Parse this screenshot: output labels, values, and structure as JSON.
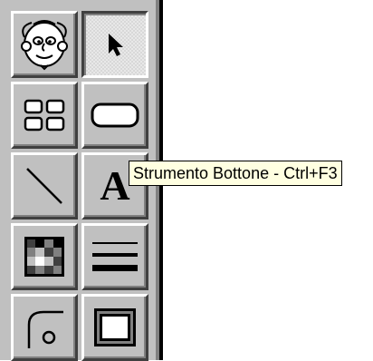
{
  "tooltip": {
    "text": "Strumento Bottone - Ctrl+F3"
  },
  "tools": [
    {
      "name": "macro-character-tool",
      "icon": "cartoon-face-icon"
    },
    {
      "name": "selection-tool",
      "icon": "pointer-arrow-icon",
      "pressed": true
    },
    {
      "name": "grid-object-tool",
      "icon": "grid-boxes-icon"
    },
    {
      "name": "button-tool",
      "icon": "rounded-rectangle-icon"
    },
    {
      "name": "line-tool",
      "icon": "diagonal-line-icon"
    },
    {
      "name": "text-tool",
      "icon": "letter-a-icon",
      "glyph": "A"
    },
    {
      "name": "color-tool",
      "icon": "color-palette-grid-icon"
    },
    {
      "name": "line-style-tool",
      "icon": "line-thickness-icon"
    },
    {
      "name": "arc-shape-tool",
      "icon": "arc-circle-icon"
    },
    {
      "name": "frame-tool",
      "icon": "beveled-frame-icon"
    }
  ],
  "colors": {
    "toolbox_face": "#c0c0c0",
    "tooltip_background": "#ffffe1",
    "palette": [
      "#000000",
      "#404040",
      "#808080",
      "#c0c0c0",
      "#ffffff"
    ]
  }
}
